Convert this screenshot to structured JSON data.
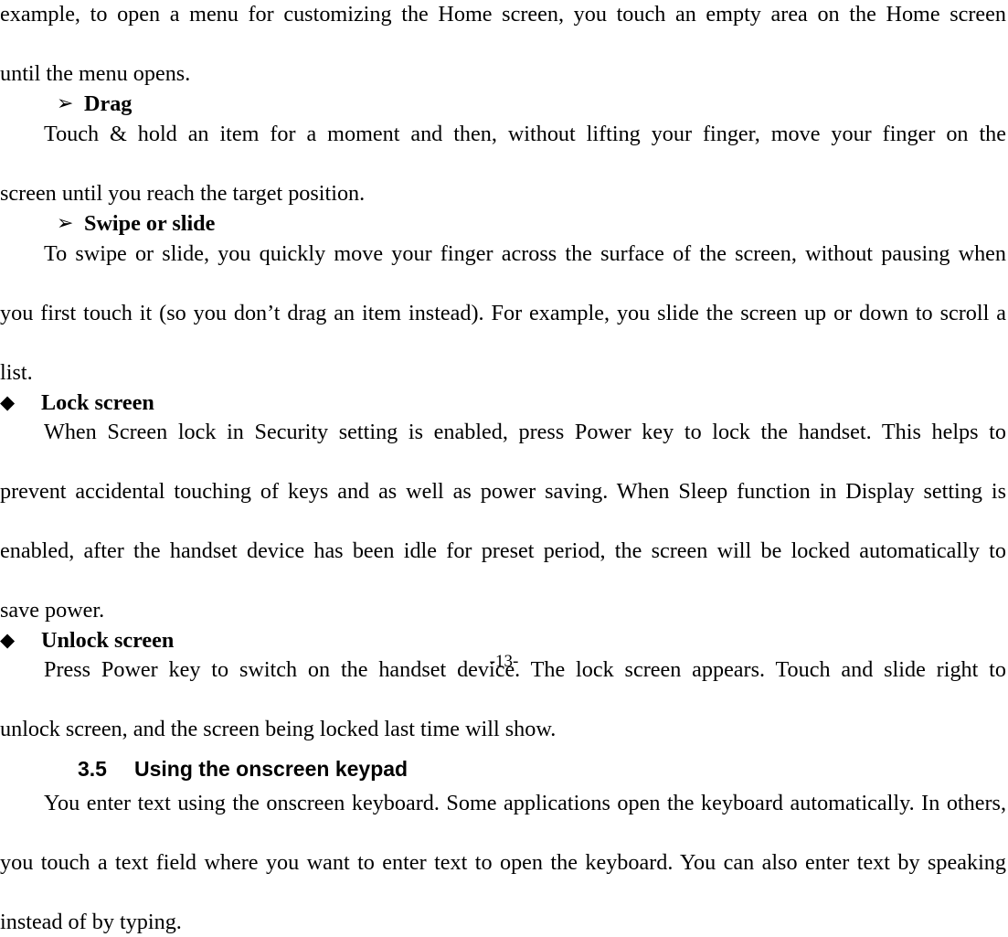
{
  "document": {
    "type": "user-manual-page",
    "page_label": "-13-",
    "page_number": 13
  },
  "bullets": {
    "arrow": "➢",
    "diamond": "◆"
  },
  "blocks": [
    {
      "id": "para-touch-and-hold-continued",
      "kind": "paragraph",
      "lines": [
        "example, to open a menu for customizing the Home screen, you touch an empty area on the Home screen",
        "until the menu opens."
      ]
    },
    {
      "id": "head-drag",
      "kind": "arrow-heading",
      "label": "Drag"
    },
    {
      "id": "para-drag",
      "kind": "paragraph",
      "lines": [
        "Touch & hold an item for a moment and then, without lifting your finger, move your finger on the",
        "screen until you reach the target position."
      ]
    },
    {
      "id": "head-swipe-or-slide",
      "kind": "arrow-heading",
      "label": "Swipe or slide"
    },
    {
      "id": "para-swipe-or-slide",
      "kind": "paragraph",
      "lines": [
        "To swipe or slide, you quickly move your finger across the surface of the screen, without pausing when",
        "you first touch it (so you don’t drag an item instead). For example, you slide the screen up or down to scroll a",
        "list."
      ]
    },
    {
      "id": "head-lock-screen",
      "kind": "diamond-heading",
      "label": "Lock screen"
    },
    {
      "id": "para-lock-screen",
      "kind": "paragraph",
      "lines": [
        "When Screen lock in Security setting is enabled, press Power key to lock the handset. This helps to",
        "prevent accidental touching of keys and as well as power saving. When Sleep function in Display setting is",
        "enabled, after the handset device has been idle for preset period, the screen will be locked automatically to",
        "save power."
      ]
    },
    {
      "id": "head-unlock-screen",
      "kind": "diamond-heading",
      "label": "Unlock screen"
    },
    {
      "id": "para-unlock-screen",
      "kind": "paragraph",
      "lines": [
        "Press Power key to switch on the handset device. The lock screen appears. Touch and slide right to",
        "unlock screen, and the screen being locked last time will show."
      ]
    },
    {
      "id": "head-section-3-5",
      "kind": "section-heading",
      "number": "3.5",
      "title": "Using the onscreen keypad"
    },
    {
      "id": "para-onscreen-keyboard",
      "kind": "paragraph",
      "lines": [
        "You enter text using the onscreen keyboard. Some applications open the keyboard automatically. In others,",
        "you touch a text field where you want to enter text to open the keyboard. You can also enter text by speaking",
        "instead of by typing."
      ]
    }
  ]
}
